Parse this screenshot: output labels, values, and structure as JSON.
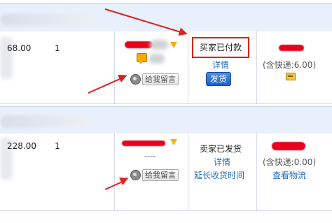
{
  "orders": [
    {
      "price": "68.00",
      "quantity": "1",
      "leave_message_label": "给我留言",
      "status_text": "买家已付款",
      "detail_link": "详情",
      "ship_button": "发货",
      "shipping_fee": "(含快递:6.00)"
    },
    {
      "price": "228.00",
      "quantity": "1",
      "buyer_contact_dash": "----",
      "leave_message_label": "给我留言",
      "status_text": "卖家已发货",
      "detail_link": "详情",
      "extend_link": "延长收货时间",
      "shipping_fee": "(含快递:0.00)",
      "view_logistics_link": "查看物流"
    }
  ],
  "colors": {
    "header_bg": "#e8f0fb",
    "highlight_border": "#d9230f",
    "annotation_arrow": "#e02020",
    "link": "#1e6bb8",
    "ship_button_bg": "#1c5fc4"
  }
}
